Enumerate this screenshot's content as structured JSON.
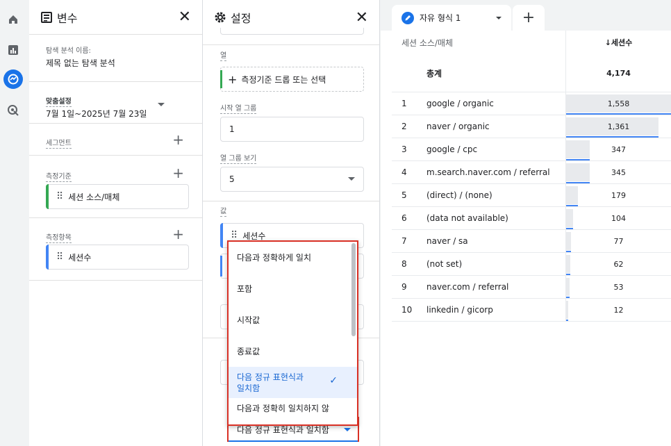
{
  "variables_panel": {
    "title": "변수",
    "exploration_name_label": "탐색 분석 이름:",
    "exploration_name": "제목 없는 탐색 분석",
    "date_label": "맞춤설정",
    "date_range": "7월 1일~2025년 7월 23일",
    "segments_label": "세그먼트",
    "dimensions_label": "측정기준",
    "dimension_chip": "세션 소스/매체",
    "metrics_label": "측정항목",
    "metric_chip": "세션수"
  },
  "settings_panel": {
    "title": "설정",
    "columns_label": "열",
    "drop_zone": "측정기준 드롭 또는 선택",
    "start_col_group_label": "시작 열 그룹",
    "start_col_group_value": "1",
    "show_col_groups_label": "열 그룹 보기",
    "show_col_groups_value": "5",
    "values_label": "값",
    "value_chip": "세션수",
    "filter_select_value": "다음 정규 표현식과 일치함"
  },
  "match_dropdown": {
    "options": [
      "다음과 정확하게 일치",
      "포함",
      "시작값",
      "종료값",
      "다음 정규 표현식과\n일치함",
      "다음과 정확히 일치하지 않"
    ],
    "selected_index": 4
  },
  "report": {
    "tab_label": "자유 형식 1",
    "dimension_header": "세션 소스/매체",
    "metric_header": "↓세션수",
    "total_label": "총계",
    "total_value": "4,174",
    "accent": "#4285f4",
    "rows": [
      {
        "idx": "1",
        "dim": "google / organic",
        "val": "1,558",
        "frac": 1.0
      },
      {
        "idx": "2",
        "dim": "naver / organic",
        "val": "1,361",
        "frac": 0.874
      },
      {
        "idx": "3",
        "dim": "google / cpc",
        "val": "347",
        "frac": 0.223
      },
      {
        "idx": "4",
        "dim": "m.search.naver.com / referral",
        "val": "345",
        "frac": 0.221
      },
      {
        "idx": "5",
        "dim": "(direct) / (none)",
        "val": "179",
        "frac": 0.115
      },
      {
        "idx": "6",
        "dim": "(data not available)",
        "val": "104",
        "frac": 0.067
      },
      {
        "idx": "7",
        "dim": "naver / sa",
        "val": "77",
        "frac": 0.049
      },
      {
        "idx": "8",
        "dim": "(not set)",
        "val": "62",
        "frac": 0.04
      },
      {
        "idx": "9",
        "dim": "naver.com / referral",
        "val": "53",
        "frac": 0.034
      },
      {
        "idx": "10",
        "dim": "linkedin / gicorp",
        "val": "12",
        "frac": 0.008
      }
    ]
  }
}
